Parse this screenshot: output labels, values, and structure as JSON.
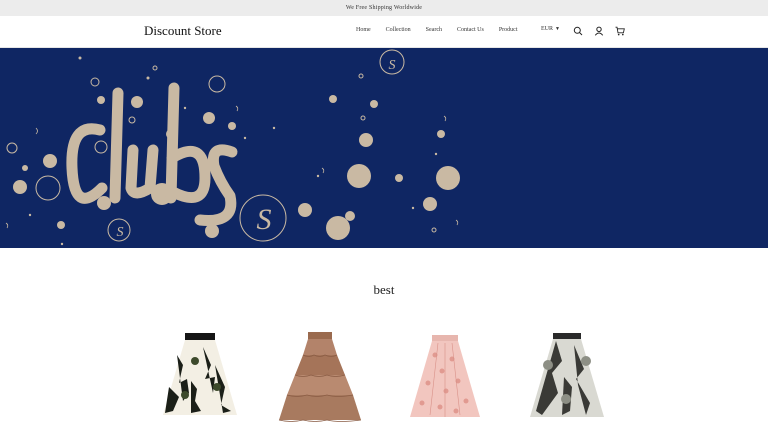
{
  "announcement": "We Free Shipping Worldwide",
  "header": {
    "brand": "Discount Store",
    "nav": [
      "Home",
      "Collection",
      "Search",
      "Contact Us",
      "Product"
    ],
    "currency": "EUR",
    "icons": [
      "search-icon",
      "account-icon",
      "cart-icon"
    ]
  },
  "hero": {
    "text_art": "Club S",
    "background_color": "#0f2663",
    "accent_color": "#c9b9a3"
  },
  "section": {
    "title": "best"
  },
  "products": [
    {
      "name": "black-floral-tulle-skirt"
    },
    {
      "name": "brown-tiered-tulle-skirt"
    },
    {
      "name": "pink-embroidered-tulle-skirt"
    },
    {
      "name": "grey-ink-print-skirt"
    }
  ]
}
